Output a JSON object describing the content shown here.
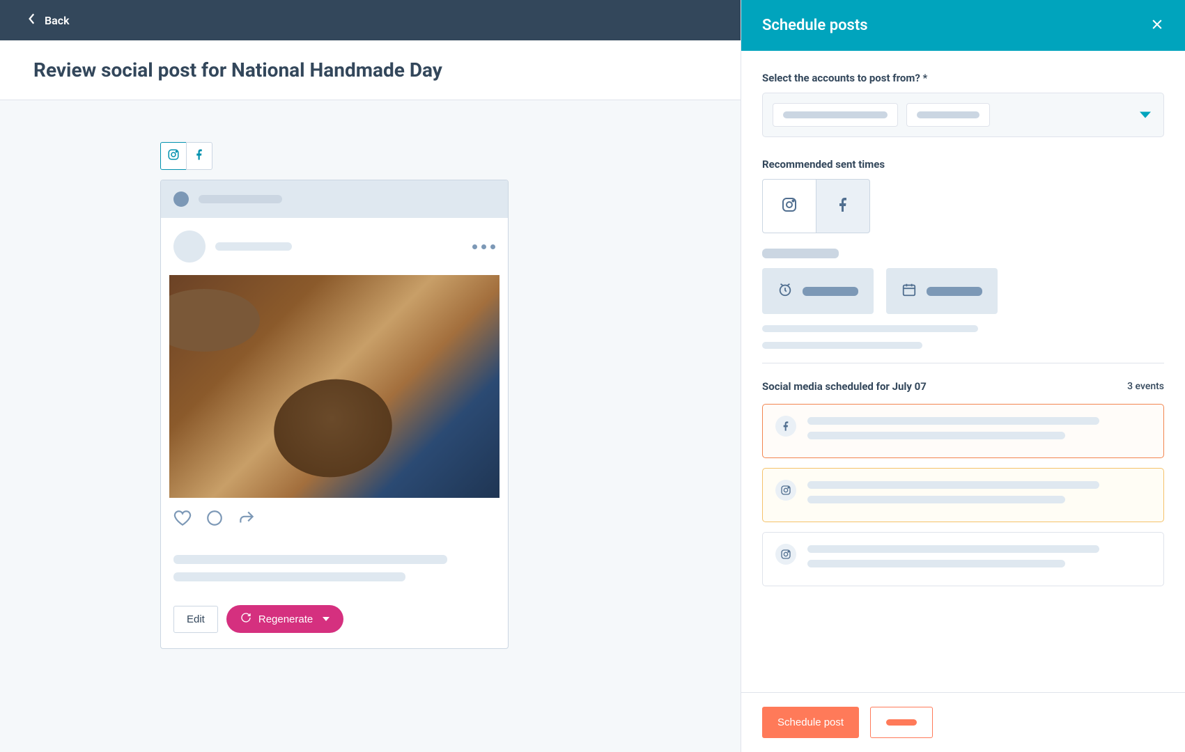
{
  "topbar": {
    "back_label": "Back"
  },
  "header": {
    "title": "Review social post for National Handmade Day"
  },
  "post_actions": {
    "edit_label": "Edit",
    "regenerate_label": "Regenerate"
  },
  "panel": {
    "title": "Schedule posts",
    "select_accounts_label": "Select the accounts to post from? *",
    "recommended_times_label": "Recommended sent times",
    "scheduled_label": "Social media scheduled for July 07",
    "events_count": "3 events",
    "schedule_button": "Schedule post"
  },
  "colors": {
    "teal": "#00a4bd",
    "orange": "#ff7a59",
    "pink": "#d5307f",
    "navy": "#33475b"
  }
}
